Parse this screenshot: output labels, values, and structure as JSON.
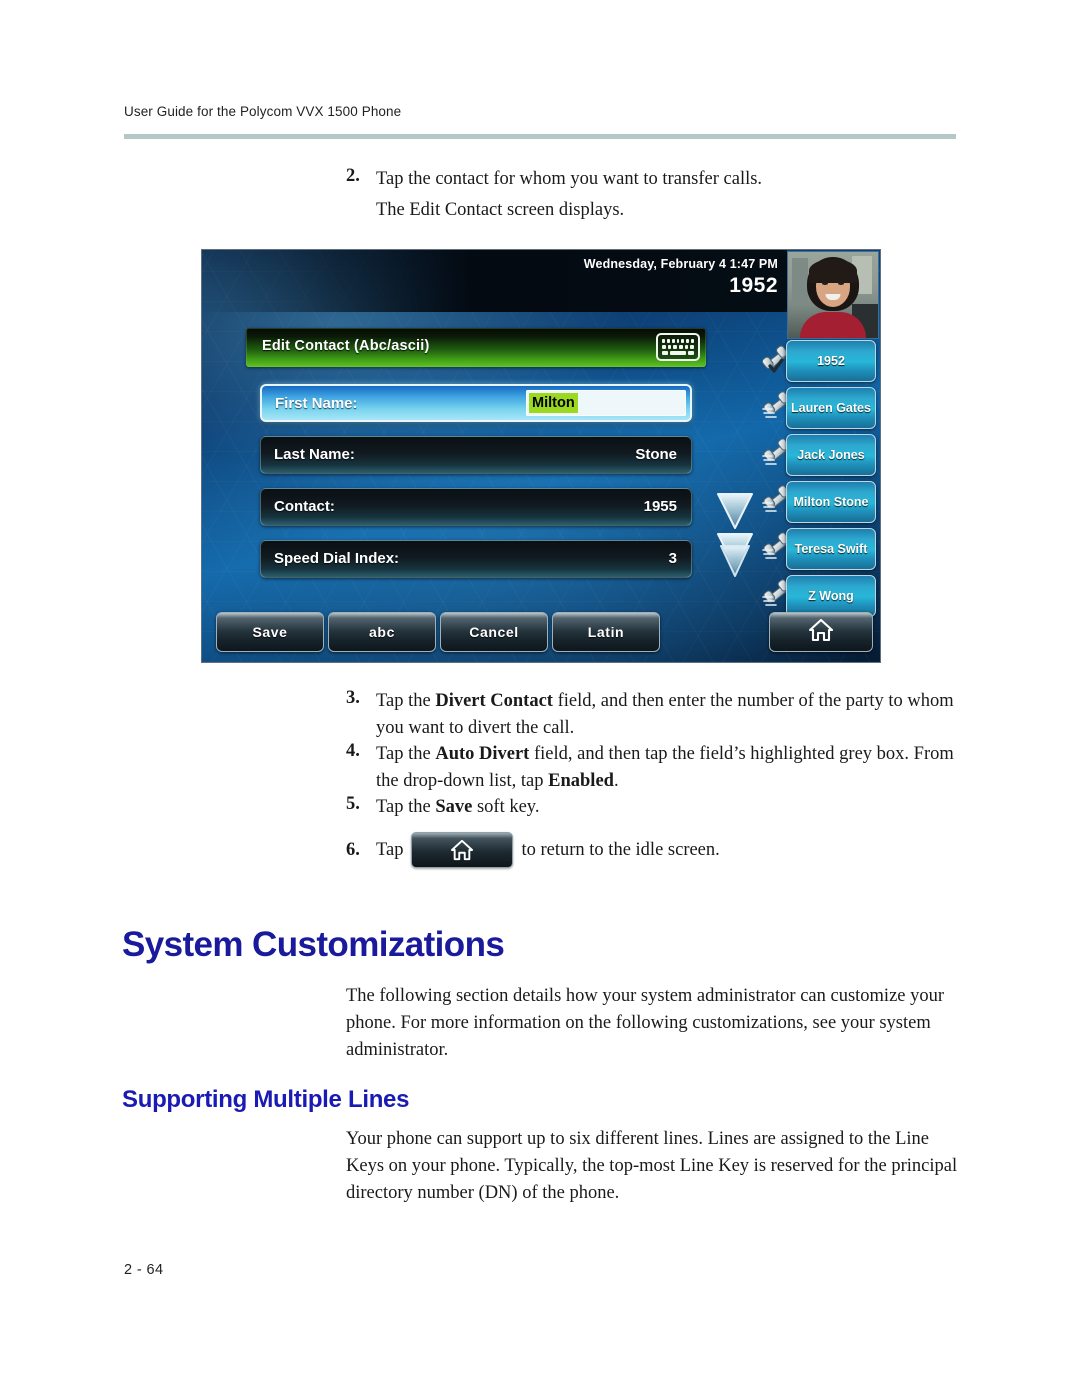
{
  "document": {
    "running_header": "User Guide for the Polycom VVX 1500 Phone",
    "page_number": "2 - 64"
  },
  "steps": {
    "step2": {
      "number": "2.",
      "text": "Tap the contact for whom you want to transfer calls.",
      "result": "The Edit Contact screen displays."
    },
    "step3": {
      "number": "3.",
      "part1": "Tap the ",
      "bold1": "Divert Contact",
      "part2": " field, and then enter the number of the party to whom you want to divert the call."
    },
    "step4": {
      "number": "4.",
      "part1": "Tap the ",
      "bold1": "Auto Divert",
      "part2": " field, and then tap the field’s highlighted grey box. From the drop-down list, tap ",
      "bold2": "Enabled",
      "part3": "."
    },
    "step5": {
      "number": "5.",
      "part1": "Tap the ",
      "bold1": "Save",
      "part2": " soft key."
    },
    "step6": {
      "number": "6.",
      "part1": "Tap",
      "part2": "to return to the idle screen."
    }
  },
  "sections": {
    "system_customizations": {
      "heading": "System Customizations",
      "paragraph": "The following section details how your system administrator can customize your phone. For more information on the following customizations, see your system administrator."
    },
    "supporting_multiple_lines": {
      "heading": "Supporting Multiple Lines",
      "paragraph": "Your phone can support up to six different lines. Lines are assigned to the Line Keys on your phone. Typically, the top-most Line Key is reserved for the principal directory number (DN) of the phone."
    }
  },
  "phone_screen": {
    "status_bar": {
      "datetime": "Wednesday, February 4  1:47 PM",
      "extension": "1952"
    },
    "title_bar": {
      "label": "Edit Contact (Abc/ascii)",
      "keyboard_icon": "keyboard-icon"
    },
    "fields": [
      {
        "label": "First Name:",
        "value": "Milton",
        "selected": true
      },
      {
        "label": "Last Name:",
        "value": "Stone",
        "selected": false
      },
      {
        "label": "Contact:",
        "value": "1955",
        "selected": false
      },
      {
        "label": "Speed Dial Index:",
        "value": "3",
        "selected": false
      }
    ],
    "line_keys": [
      {
        "label": "1952",
        "icon": "handset-registered-icon"
      },
      {
        "label": "Lauren Gates",
        "icon": "handset-icon"
      },
      {
        "label": "Jack Jones",
        "icon": "handset-icon"
      },
      {
        "label": "Milton Stone",
        "icon": "handset-icon"
      },
      {
        "label": "Teresa Swift",
        "icon": "handset-icon"
      },
      {
        "label": "Z Wong",
        "icon": "handset-icon"
      }
    ],
    "soft_keys": [
      {
        "label": "Save"
      },
      {
        "label": "abc"
      },
      {
        "label": "Cancel"
      },
      {
        "label": "Latin"
      }
    ],
    "home_key": {
      "icon": "home-icon"
    },
    "scroll_arrows": {
      "icon": "scroll-down-arrows-icon"
    },
    "video_thumbnail": {
      "name": "self-view-video"
    }
  },
  "colors": {
    "heading_blue": "#1a1a9c",
    "header_rule": "#b4c9c6",
    "titlebar_green": "#3f9c17",
    "selected_field_cyan": "#3fa5e0",
    "entry_highlight_green": "#9bd820",
    "linekey_blue": "#27b7d8"
  }
}
